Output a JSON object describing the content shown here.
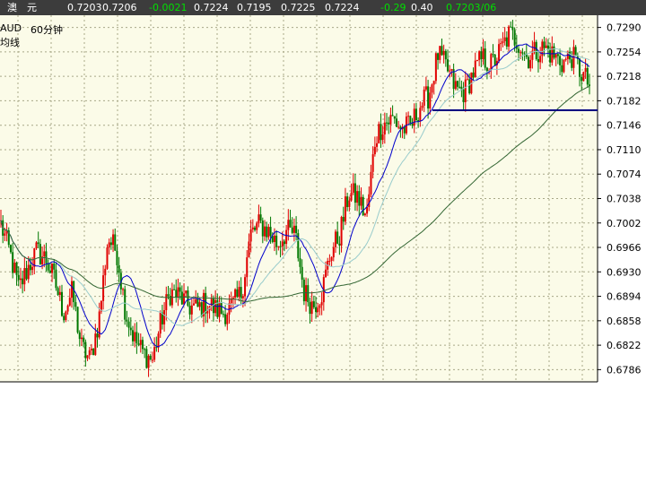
{
  "quote_bar": {
    "symbol": "澳　元",
    "bid": "0.7203",
    "ask": "0.7206",
    "change": "-0.0021",
    "open": "0.7224",
    "low": "0.7195",
    "high": "0.7225",
    "prev": "0.7224",
    "change_pct": "-0.29",
    "spread": "0.40",
    "last": "0.7203/06"
  },
  "legend": {
    "symbol": "AUD",
    "period": "60分钟",
    "indicator": "均线"
  },
  "colors": {
    "background": "#fbfbe8",
    "grid": "#a8a888",
    "up_candle": "#e00000",
    "down_candle": "#007800",
    "ma_fast": "#0000cc",
    "ma_mid": "#99cccc",
    "ma_slow": "#336633",
    "support_line": "#000080"
  },
  "chart_data": {
    "type": "candlestick",
    "y_axis_ticks": [
      "0.7290",
      "0.7254",
      "0.7218",
      "0.7182",
      "0.7146",
      "0.7110",
      "0.7074",
      "0.7038",
      "0.7002",
      "0.6966",
      "0.6930",
      "0.6894",
      "0.6858",
      "0.6822",
      "0.6786"
    ],
    "ylim": [
      0.6768,
      0.7308
    ],
    "grid": true,
    "horizontal_line": 0.7168,
    "price_path": [
      0.7,
      0.6958,
      0.6905,
      0.6935,
      0.696,
      0.695,
      0.6918,
      0.687,
      0.69,
      0.682,
      0.68,
      0.686,
      0.698,
      0.696,
      0.687,
      0.683,
      0.681,
      0.68,
      0.686,
      0.69,
      0.6895,
      0.688,
      0.6875,
      0.6885,
      0.6875,
      0.687,
      0.688,
      0.69,
      0.6985,
      0.7,
      0.699,
      0.697,
      0.699,
      0.6985,
      0.69,
      0.688,
      0.69,
      0.696,
      0.6985,
      0.7045,
      0.704,
      0.701,
      0.713,
      0.715,
      0.7155,
      0.714,
      0.7145,
      0.7175,
      0.719,
      0.725,
      0.723,
      0.72,
      0.7195,
      0.7225,
      0.7245,
      0.7235,
      0.7255,
      0.728,
      0.727,
      0.7245,
      0.7255,
      0.726,
      0.7248,
      0.7238,
      0.7248,
      0.7225,
      0.7205
    ],
    "moving_averages": [
      {
        "period": 5
      },
      {
        "period": 10
      },
      {
        "period": 40
      }
    ]
  }
}
